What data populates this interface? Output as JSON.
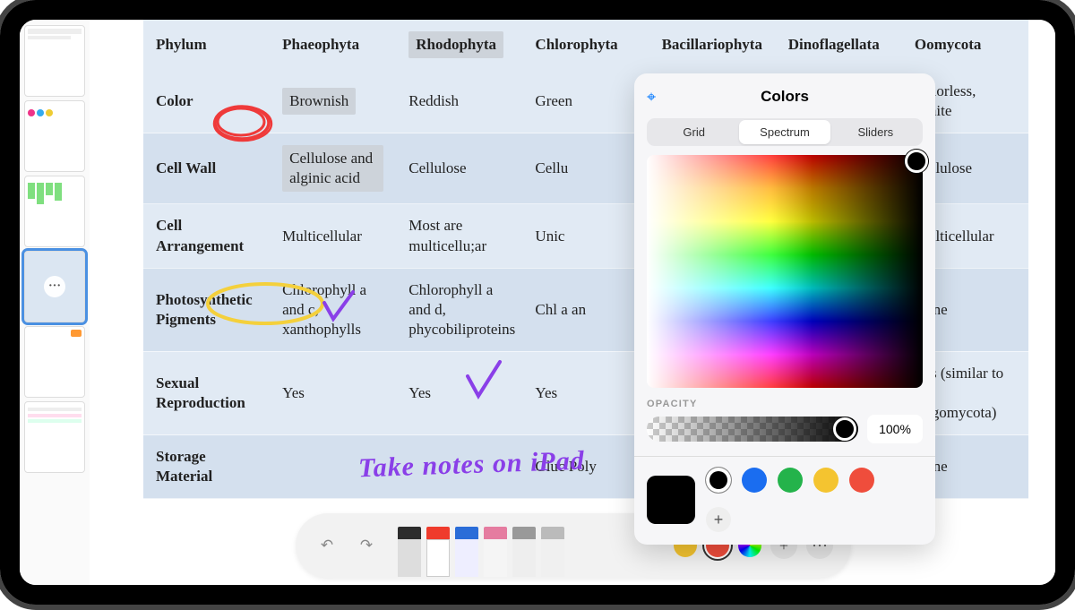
{
  "handwritten_note": "Take notes on iPad",
  "table": {
    "headers": [
      "Phylum",
      "Phaeophyta",
      "Rhodophyta",
      "Chlorophyta",
      "Bacillariophyta",
      "Dinoflagellata",
      "Oomycota"
    ],
    "rows": [
      {
        "label": "Color",
        "cells": [
          "Brownish",
          "Reddish",
          "Green",
          "",
          "",
          "Colorless, White"
        ]
      },
      {
        "label": "Cell Wall",
        "cells": [
          "Cellulose and alginic acid",
          "Cellulose",
          "Cellu",
          "",
          "",
          "Cellulose"
        ]
      },
      {
        "label": "Cell Arrangement",
        "cells": [
          "Multicellular",
          "Most are multicellu;ar",
          "Unic",
          "",
          "",
          "Multicellular"
        ]
      },
      {
        "label": "Photosynthetic Pigments",
        "cells": [
          "Chlorophyll a and c, xanthophylls",
          "Chlorophyll a and d, phycobiliproteins",
          "Chl\na an",
          "",
          "",
          "None"
        ]
      },
      {
        "label": "Sexual Reproduction",
        "cells": [
          "Yes",
          "Yes",
          "Yes",
          "",
          "",
          "Yes (similar to the Zygomycota)"
        ]
      },
      {
        "label": "Storage Material",
        "cells": [
          "",
          "",
          "Gluc\nPoly",
          "",
          "",
          "None"
        ]
      }
    ],
    "highlighted_header_index": 2,
    "highlighted_cells": [
      [
        0,
        0
      ],
      [
        1,
        0
      ]
    ]
  },
  "color_popover": {
    "title": "Colors",
    "tabs": [
      "Grid",
      "Spectrum",
      "Sliders"
    ],
    "active_tab": 1,
    "opacity_label": "OPACITY",
    "opacity_value": "100%",
    "current_color": "#000000",
    "recent_colors": [
      "#000000",
      "#1a6df0",
      "#24b34b",
      "#f4c430",
      "#ef4d3c"
    ],
    "add_label": "+"
  },
  "toolbar": {
    "undo_glyph": "↶",
    "redo_glyph": "↷",
    "tool_tips": [
      "#2c2c2c",
      "#ef3b2c",
      "#2a6dd8",
      "#e57ca0",
      "#999999",
      "#bbbbbb"
    ],
    "swatches": [
      "#f4c430",
      "#ef4d3c"
    ],
    "add_glyph": "+",
    "more_glyph": "···"
  },
  "sidebar": {
    "active_index": 3,
    "page_count": 6
  }
}
